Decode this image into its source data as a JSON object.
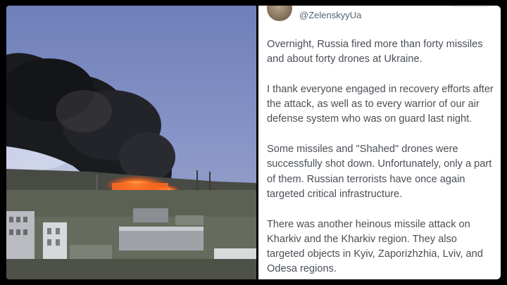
{
  "photo": {
    "description_icon": "smoke-and-fire-scene"
  },
  "tweet": {
    "handle": "@ZelenskyyUa",
    "paragraphs": [
      "Overnight, Russia fired more than forty missiles and about forty drones at Ukraine.",
      "I thank everyone engaged in recovery efforts after the attack, as well as to every warrior of our air defense system who was on guard last night.",
      "Some missiles and \"Shahed\" drones were successfully shot down. Unfortunately, only a part of them. Russian terrorists have once again targeted critical infrastructure.",
      "There was another heinous missile attack on Kharkiv and the Kharkiv region. They also targeted objects in Kyiv, Zaporizhzhia, Lviv, and Odesa regions."
    ]
  },
  "colors": {
    "background": "#000000",
    "tweet_text": "#4a4f55",
    "handle": "#536471",
    "sky": "#7f8fc2",
    "fire": "#ff5a1f"
  }
}
